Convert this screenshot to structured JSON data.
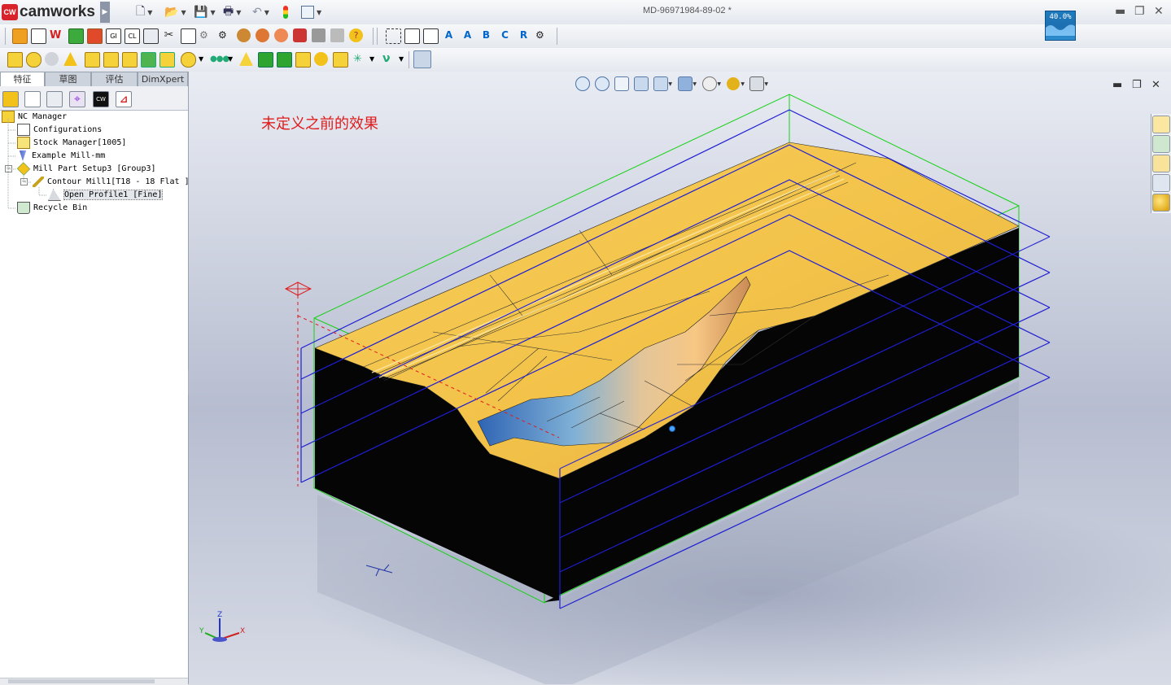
{
  "app": {
    "logo_text": "camworks",
    "logo_badge": "CW",
    "document_title": "MD-96971984-89-02 *",
    "zoom_percent": "40.0%",
    "accent_color": "#1d6fb0"
  },
  "window_controls": [
    "minimize-icon",
    "restore-icon",
    "close-icon"
  ],
  "quick_access": [
    "new-document-icon",
    "open-icon",
    "save-icon",
    "print-icon",
    "undo-icon",
    "rebuild-icon",
    "options-icon"
  ],
  "left_panel": {
    "tabs": [
      {
        "label": "特征",
        "active": true
      },
      {
        "label": "草图",
        "active": false
      },
      {
        "label": "评估",
        "active": false
      },
      {
        "label": "DimXpert",
        "active": false
      }
    ],
    "manager_icons": [
      "feature-manager-icon",
      "property-manager-icon",
      "configuration-manager-icon",
      "dimxpert-manager-icon",
      "camworks-feature-tree-icon",
      "camworks-operation-tree-icon"
    ],
    "tree": [
      {
        "label": "NC Manager",
        "level": 0,
        "icon": "nc-manager-icon"
      },
      {
        "label": "Configurations",
        "level": 1,
        "icon": "configurations-icon"
      },
      {
        "label": "Stock Manager[1005]",
        "level": 1,
        "icon": "stock-manager-icon"
      },
      {
        "label": "Example Mill-mm",
        "level": 1,
        "icon": "machine-icon"
      },
      {
        "label": "Mill Part Setup3 [Group3]",
        "level": 1,
        "icon": "part-setup-icon",
        "expander": "−"
      },
      {
        "label": "Contour Mill1[T18 - 18 Flat ]",
        "level": 2,
        "icon": "contour-mill-icon",
        "expander": "−"
      },
      {
        "label": "Open Profile1 [Fine]",
        "level": 3,
        "icon": "open-profile-icon",
        "selected": true
      },
      {
        "label": "Recycle Bin",
        "level": 1,
        "icon": "recycle-bin-icon"
      }
    ]
  },
  "viewport": {
    "annotation": "未定义之前的效果",
    "heads_up_icons": [
      "zoom-to-fit-icon",
      "zoom-to-area-icon",
      "previous-view-icon",
      "section-view-icon",
      "view-orientation-icon",
      "display-style-icon",
      "hide-show-items-icon",
      "edit-appearance-icon",
      "apply-scene-icon"
    ],
    "task_pane_icons": [
      "solidworks-resources-icon",
      "design-library-icon",
      "file-explorer-icon",
      "view-palette-icon",
      "appearances-icon"
    ],
    "triad_labels": {
      "x": "X",
      "y": "Y",
      "z": "Z"
    }
  }
}
